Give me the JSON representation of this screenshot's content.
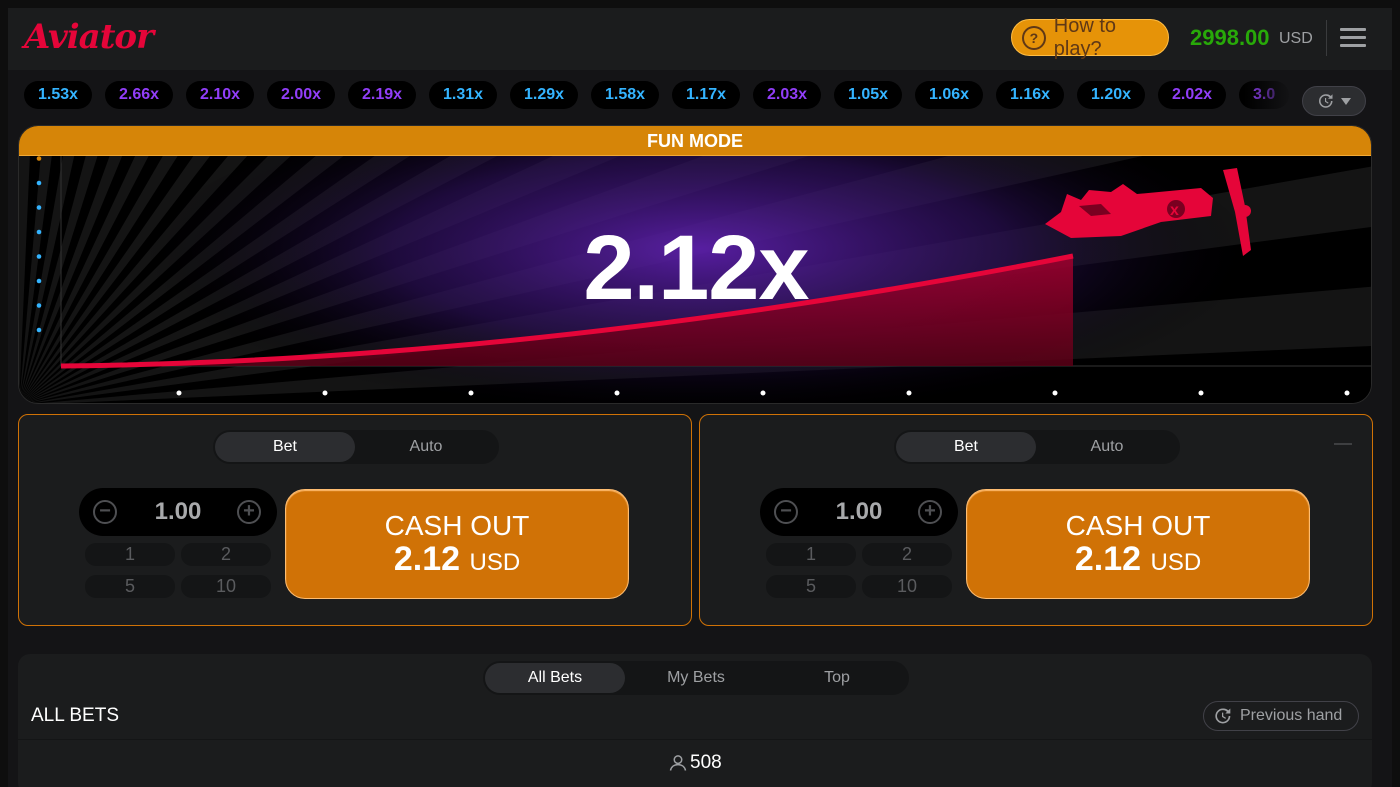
{
  "header": {
    "logo": "Aviator",
    "how_to_play": "How to play?",
    "balance": "2998.00",
    "currency": "USD"
  },
  "history": [
    "1.53x",
    "2.66x",
    "2.10x",
    "2.00x",
    "2.19x",
    "1.31x",
    "1.29x",
    "1.58x",
    "1.17x",
    "2.03x",
    "1.05x",
    "1.06x",
    "1.16x",
    "1.20x",
    "2.02x",
    "3.0"
  ],
  "history_colors": [
    "#34b4ff",
    "#913ef8",
    "#913ef8",
    "#913ef8",
    "#913ef8",
    "#34b4ff",
    "#34b4ff",
    "#34b4ff",
    "#34b4ff",
    "#913ef8",
    "#34b4ff",
    "#34b4ff",
    "#34b4ff",
    "#34b4ff",
    "#913ef8",
    "#913ef8"
  ],
  "game": {
    "mode_banner": "FUN MODE",
    "multiplier": "2.12x",
    "colors": {
      "curve": "#e50539",
      "banner": "#d68508",
      "glow": "#5b1fa8"
    }
  },
  "panels": [
    {
      "tab_bet": "Bet",
      "tab_auto": "Auto",
      "amount": "1.00",
      "quick": [
        "1",
        "2",
        "5",
        "10"
      ],
      "cashout_label": "CASH OUT",
      "cashout_amount": "2.12",
      "cashout_currency": "USD"
    },
    {
      "tab_bet": "Bet",
      "tab_auto": "Auto",
      "amount": "1.00",
      "quick": [
        "1",
        "2",
        "5",
        "10"
      ],
      "cashout_label": "CASH OUT",
      "cashout_amount": "2.12",
      "cashout_currency": "USD"
    }
  ],
  "bets": {
    "tabs": [
      "All Bets",
      "My Bets",
      "Top"
    ],
    "title": "ALL BETS",
    "previous_hand": "Previous hand",
    "players": "508"
  }
}
